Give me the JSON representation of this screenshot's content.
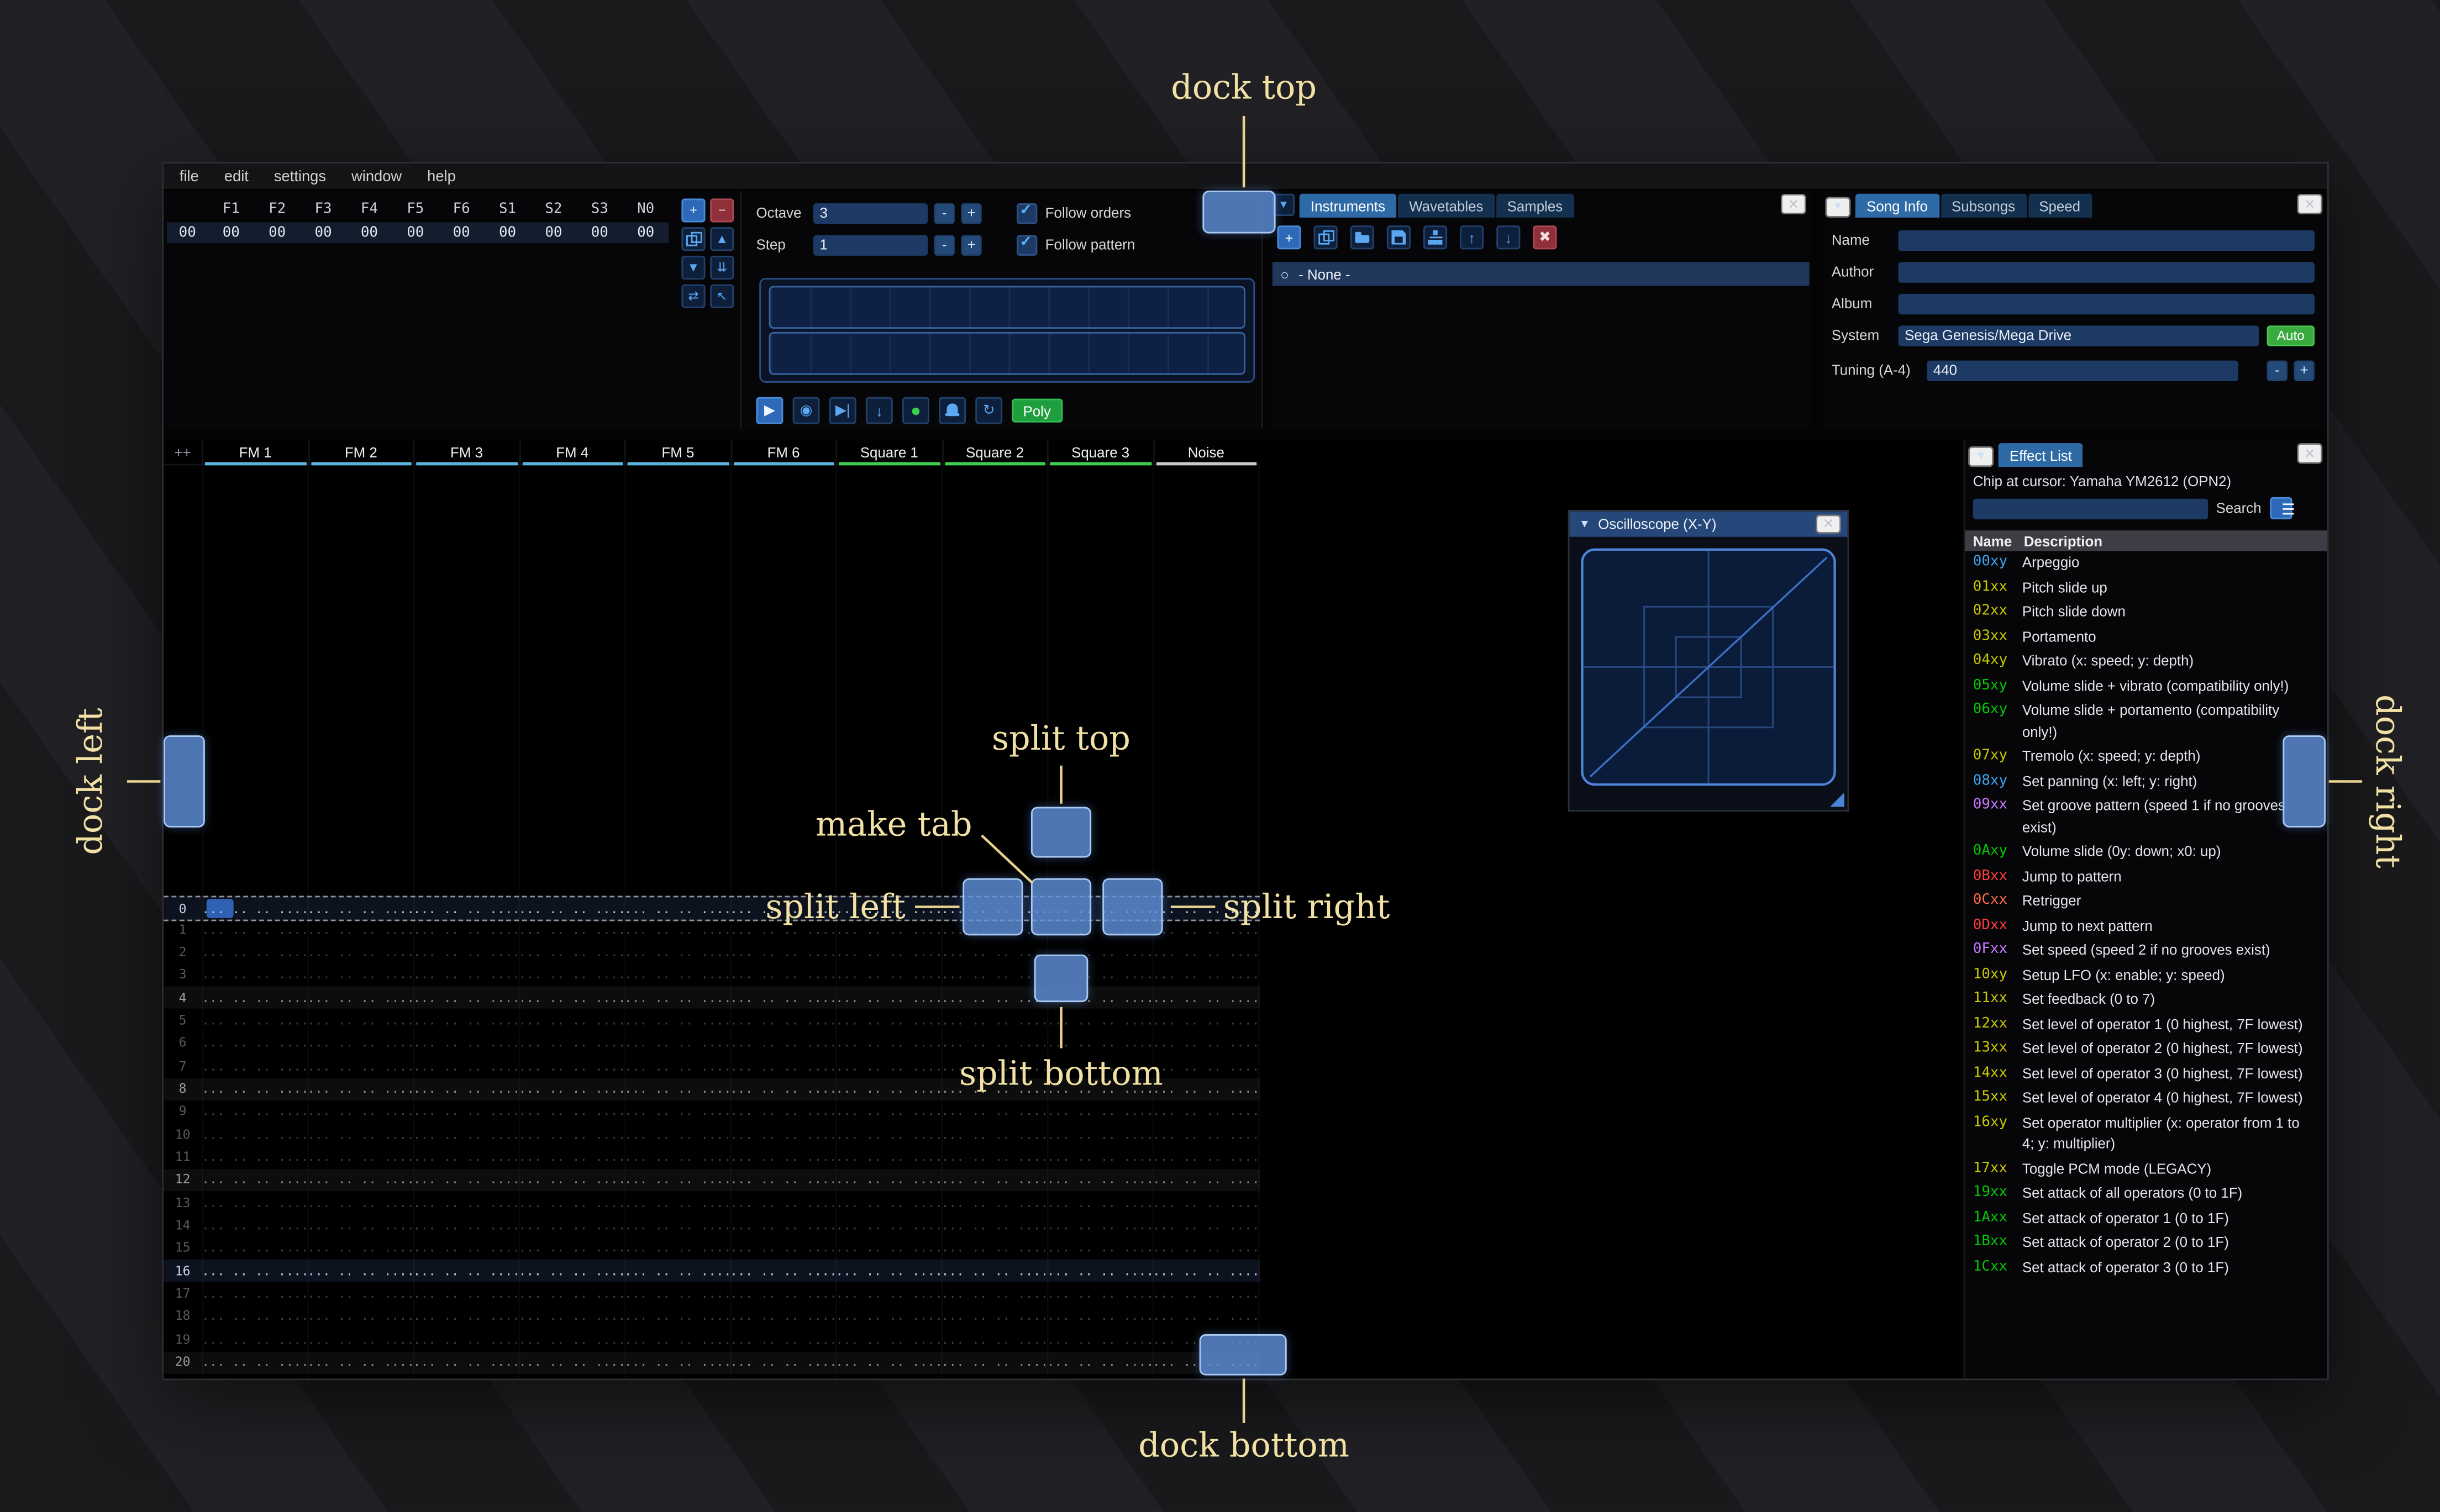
{
  "menu": {
    "items": [
      "file",
      "edit",
      "settings",
      "window",
      "help"
    ]
  },
  "orders": {
    "index_value": "00",
    "channels": [
      "F1",
      "F2",
      "F3",
      "F4",
      "F5",
      "F6",
      "S1",
      "S2",
      "S3",
      "N0"
    ],
    "values": [
      "00",
      "00",
      "00",
      "00",
      "00",
      "00",
      "00",
      "00",
      "00",
      "00"
    ],
    "buttons": [
      {
        "name": "add-order-button",
        "icon": "plus",
        "variant": "accent"
      },
      {
        "name": "remove-order-button",
        "icon": "minus",
        "variant": "danger"
      },
      {
        "name": "duplicate-order-button",
        "icon": "duplicate",
        "variant": ""
      },
      {
        "name": "move-order-up-button",
        "icon": "chevron-up",
        "variant": ""
      },
      {
        "name": "move-order-down-button",
        "icon": "chevron-down",
        "variant": ""
      },
      {
        "name": "duplicate-order-end-button",
        "icon": "chevron-double-down",
        "variant": ""
      },
      {
        "name": "change-all-orders-button",
        "icon": "swap",
        "variant": ""
      },
      {
        "name": "order-edit-mode-button",
        "icon": "cursor",
        "variant": ""
      }
    ]
  },
  "controls": {
    "octave_label": "Octave",
    "octave_value": "3",
    "step_label": "Step",
    "step_value": "1",
    "dec_label": "-",
    "inc_label": "+",
    "follow_orders_label": "Follow orders",
    "follow_pattern_label": "Follow pattern",
    "poly_label": "Poly",
    "playback_buttons": [
      {
        "name": "play-button",
        "icon": "play",
        "variant": "accent"
      },
      {
        "name": "play-pattern-button",
        "icon": "play-circle",
        "variant": ""
      },
      {
        "name": "step-row-button",
        "icon": "step",
        "variant": ""
      },
      {
        "name": "play-from-cursor-button",
        "icon": "arrow-down",
        "variant": ""
      },
      {
        "name": "edit-record-button",
        "icon": "record",
        "variant": "record"
      },
      {
        "name": "metronome-button",
        "icon": "bell",
        "variant": ""
      },
      {
        "name": "repeat-pattern-button",
        "icon": "repeat",
        "variant": ""
      }
    ]
  },
  "instruments": {
    "tabs": [
      {
        "label": "Instruments",
        "active": true
      },
      {
        "label": "Wavetables",
        "active": false
      },
      {
        "label": "Samples",
        "active": false
      }
    ],
    "toolbar": [
      {
        "name": "add-instrument-button",
        "icon": "plus",
        "variant": "accent"
      },
      {
        "name": "duplicate-instrument-button",
        "icon": "duplicate",
        "variant": ""
      },
      {
        "name": "open-instrument-button",
        "icon": "folder",
        "variant": ""
      },
      {
        "name": "save-instrument-button",
        "icon": "save",
        "variant": ""
      },
      {
        "name": "instrument-folders-button",
        "icon": "sitemap",
        "variant": ""
      },
      {
        "name": "move-instrument-up-button",
        "icon": "arrow-up",
        "variant": ""
      },
      {
        "name": "move-instrument-down-button",
        "icon": "arrow-down",
        "variant": ""
      },
      {
        "name": "delete-instrument-button",
        "icon": "delete",
        "variant": "danger"
      }
    ],
    "items": [
      {
        "label": "- None -",
        "selected": true
      }
    ]
  },
  "song_info": {
    "tabs": [
      {
        "label": "Song Info",
        "active": true
      },
      {
        "label": "Subsongs",
        "active": false
      },
      {
        "label": "Speed",
        "active": false
      }
    ],
    "fields": [
      {
        "label": "Name",
        "value": ""
      },
      {
        "label": "Author",
        "value": ""
      },
      {
        "label": "Album",
        "value": ""
      }
    ],
    "system_label": "System",
    "system_value": "Sega Genesis/Mega Drive",
    "auto_label": "Auto",
    "tuning_label": "Tuning (A-4)",
    "tuning_value": "440",
    "dec_label": "-",
    "inc_label": "+"
  },
  "pattern": {
    "corner_label": "++",
    "channels": [
      {
        "name": "FM 1",
        "color": "#5ab4dc"
      },
      {
        "name": "FM 2",
        "color": "#5ab4dc"
      },
      {
        "name": "FM 3",
        "color": "#5ab4dc"
      },
      {
        "name": "FM 4",
        "color": "#5ab4dc"
      },
      {
        "name": "FM 5",
        "color": "#5ab4dc"
      },
      {
        "name": "FM 6",
        "color": "#5ab4dc"
      },
      {
        "name": "Square 1",
        "color": "#3ecf52"
      },
      {
        "name": "Square 2",
        "color": "#3ecf52"
      },
      {
        "name": "Square 3",
        "color": "#3ecf52"
      },
      {
        "name": "Noise",
        "color": "#c8c8c8"
      }
    ],
    "row_count": 22,
    "empty_cell": "... .. .. ...."
  },
  "oscilloscope": {
    "title": "Oscilloscope (X-Y)"
  },
  "effect_list": {
    "title": "Effect List",
    "chip_text": "Chip at cursor: Yamaha YM2612 (OPN2)",
    "search_value": "",
    "search_label": "Search",
    "columns": [
      "Name",
      "Description"
    ],
    "effects": [
      {
        "code": "00xy",
        "color": "#3da5f0",
        "desc": "Arpeggio"
      },
      {
        "code": "01xx",
        "color": "#c8c800",
        "desc": "Pitch slide up"
      },
      {
        "code": "02xx",
        "color": "#c8c800",
        "desc": "Pitch slide down"
      },
      {
        "code": "03xx",
        "color": "#c8c800",
        "desc": "Portamento"
      },
      {
        "code": "04xy",
        "color": "#c8c800",
        "desc": "Vibrato (x: speed; y: depth)"
      },
      {
        "code": "05xy",
        "color": "#00c800",
        "desc": "Volume slide + vibrato (compatibility only!)"
      },
      {
        "code": "06xy",
        "color": "#00c800",
        "desc": "Volume slide + portamento (compatibility only!)"
      },
      {
        "code": "07xy",
        "color": "#c8c800",
        "desc": "Tremolo (x: speed; y: depth)"
      },
      {
        "code": "08xy",
        "color": "#3da5f0",
        "desc": "Set panning (x: left; y: right)"
      },
      {
        "code": "09xx",
        "color": "#c878ff",
        "desc": "Set groove pattern (speed 1 if no grooves exist)"
      },
      {
        "code": "0Axy",
        "color": "#00c800",
        "desc": "Volume slide (0y: down; x0: up)"
      },
      {
        "code": "0Bxx",
        "color": "#ff3c3c",
        "desc": "Jump to pattern"
      },
      {
        "code": "0Cxx",
        "color": "#ff6a47",
        "desc": "Retrigger"
      },
      {
        "code": "0Dxx",
        "color": "#ff3c3c",
        "desc": "Jump to next pattern"
      },
      {
        "code": "0Fxx",
        "color": "#c878ff",
        "desc": "Set speed (speed 2 if no grooves exist)"
      },
      {
        "code": "10xy",
        "color": "#c8c800",
        "desc": "Setup LFO (x: enable; y: speed)"
      },
      {
        "code": "11xx",
        "color": "#c8c800",
        "desc": "Set feedback (0 to 7)"
      },
      {
        "code": "12xx",
        "color": "#c8c800",
        "desc": "Set level of operator 1 (0 highest, 7F lowest)"
      },
      {
        "code": "13xx",
        "color": "#c8c800",
        "desc": "Set level of operator 2 (0 highest, 7F lowest)"
      },
      {
        "code": "14xx",
        "color": "#c8c800",
        "desc": "Set level of operator 3 (0 highest, 7F lowest)"
      },
      {
        "code": "15xx",
        "color": "#c8c800",
        "desc": "Set level of operator 4 (0 highest, 7F lowest)"
      },
      {
        "code": "16xy",
        "color": "#c8c800",
        "desc": "Set operator multiplier (x: operator from 1 to 4; y: multiplier)"
      },
      {
        "code": "17xx",
        "color": "#c8c800",
        "desc": "Toggle PCM mode (LEGACY)"
      },
      {
        "code": "19xx",
        "color": "#00c800",
        "desc": "Set attack of all operators (0 to 1F)"
      },
      {
        "code": "1Axx",
        "color": "#00c800",
        "desc": "Set attack of operator 1 (0 to 1F)"
      },
      {
        "code": "1Bxx",
        "color": "#00c800",
        "desc": "Set attack of operator 2 (0 to 1F)"
      },
      {
        "code": "1Cxx",
        "color": "#00c800",
        "desc": "Set attack of operator 3 (0 to 1F)"
      }
    ]
  },
  "annotations": {
    "dock_top": "dock top",
    "dock_bottom": "dock bottom",
    "dock_left": "dock left",
    "dock_right": "dock right",
    "split_top": "split top",
    "split_bottom": "split bottom",
    "split_left": "split left",
    "split_right": "split right",
    "make_tab": "make tab"
  }
}
